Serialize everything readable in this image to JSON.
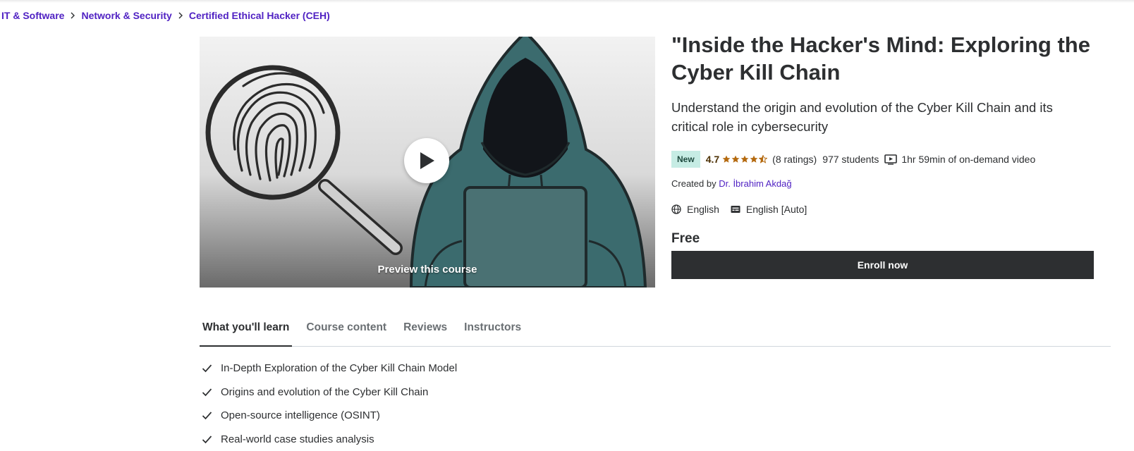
{
  "breadcrumb": [
    {
      "label": "IT & Software"
    },
    {
      "label": "Network & Security"
    },
    {
      "label": "Certified Ethical Hacker (CEH)"
    }
  ],
  "preview": {
    "label": "Preview this course",
    "play_icon": "play-icon"
  },
  "course": {
    "title": "\"Inside the Hacker's Mind: Exploring the Cyber Kill Chain",
    "subtitle": "Understand the origin and evolution of the Cyber Kill Chain and its critical role in cybersecurity",
    "badge": "New",
    "rating": "4.7",
    "rating_value": 4.7,
    "ratings_count": "(8 ratings)",
    "students": "977 students",
    "duration": "1hr 59min of on-demand video",
    "created_by": "Created by",
    "instructor": "Dr. İbrahim Akdağ",
    "language": "English",
    "captions": "English [Auto]",
    "price": "Free",
    "enroll_label": "Enroll now"
  },
  "tabs": [
    {
      "label": "What you'll learn",
      "active": true
    },
    {
      "label": "Course content",
      "active": false
    },
    {
      "label": "Reviews",
      "active": false
    },
    {
      "label": "Instructors",
      "active": false
    }
  ],
  "learn": [
    "In-Depth Exploration of the Cyber Kill Chain Model",
    "Origins and evolution of the Cyber Kill Chain",
    "Open-source intelligence (OSINT)",
    "Real-world case studies analysis"
  ],
  "colors": {
    "link": "#5022c3",
    "text": "#2d2f31",
    "badge_bg": "#c6ece4",
    "star": "#b4690e",
    "button_bg": "#2d2f31"
  },
  "icons": {
    "chevron": "chevron-right-icon",
    "star": "star-icon",
    "video": "video-icon",
    "globe": "globe-icon",
    "captions": "captions-icon",
    "check": "check-icon"
  }
}
